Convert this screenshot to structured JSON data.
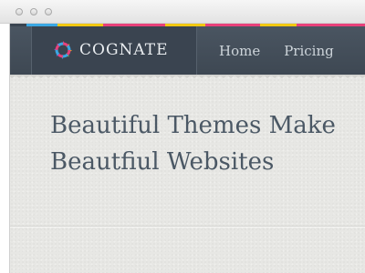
{
  "window": {
    "controls": [
      "close",
      "minimize",
      "zoom"
    ]
  },
  "nav": {
    "brand": "COGNATE",
    "logo_icon": "gear-icon",
    "links": [
      "Home",
      "Pricing"
    ],
    "strip_colors": [
      "#3aa7e3",
      "#f2c811",
      "#e8407a",
      "#f2c811",
      "#e8407a",
      "#f2c811",
      "#e8407a"
    ]
  },
  "hero": {
    "line1": "Beautiful Themes Make",
    "line2": "Beautfiul Websites"
  },
  "colors": {
    "navbar": "#434e5a",
    "heading": "#4b5865",
    "background": "#e7e7e4"
  }
}
